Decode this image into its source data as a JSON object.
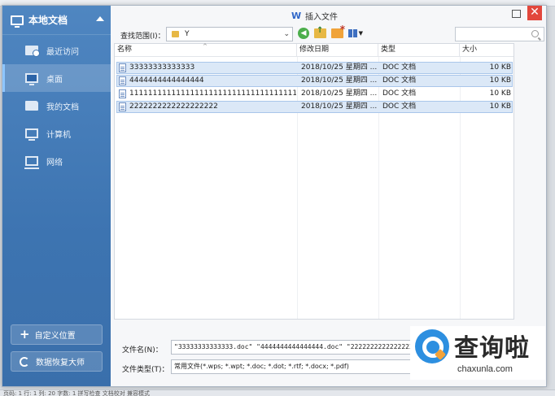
{
  "dialog": {
    "title": "插入文件",
    "close_glyph": "✕"
  },
  "sidebar": {
    "header": "本地文档",
    "items": [
      {
        "label": "最近访问"
      },
      {
        "label": "桌面"
      },
      {
        "label": "我的文档"
      },
      {
        "label": "计算机"
      },
      {
        "label": "网络"
      }
    ],
    "custom_location": "自定义位置",
    "data_recovery": "数据恢复大师"
  },
  "lookin": {
    "label": "查找范围(I)：",
    "value": "Y",
    "arrow": "⌄"
  },
  "columns": {
    "name": "名称",
    "modified": "修改日期",
    "type": "类型",
    "size": "大小",
    "sort_caret": "^"
  },
  "files": [
    {
      "name": "33333333333333",
      "modified": "2018/10/25 星期四 ...",
      "type": "DOC 文档",
      "size": "10 KB",
      "selected": true
    },
    {
      "name": "4444444444444444",
      "modified": "2018/10/25 星期四 ...",
      "type": "DOC 文档",
      "size": "10 KB",
      "selected": true
    },
    {
      "name": "111111111111111111111111111111111111...",
      "modified": "2018/10/25 星期四 ...",
      "type": "DOC 文档",
      "size": "10 KB",
      "selected": false
    },
    {
      "name": "2222222222222222222",
      "modified": "2018/10/25 星期四 ...",
      "type": "DOC 文档",
      "size": "10 KB",
      "selected": true
    }
  ],
  "filename": {
    "label": "文件名(N)：",
    "value": "\"33333333333333.doc\" \"4444444444444444.doc\" \"2222222222222222222\""
  },
  "filetype": {
    "label": "文件类型(T)：",
    "value": "常用文件(*.wps; *.wpt; *.doc; *.dot; *.rtf; *.docx; *.pdf)"
  },
  "statusbar": {
    "text": "页码: 1  行: 1  列: 20  字数: 1  拼写检查  文档校对  兼容模式"
  },
  "watermark": {
    "cn": "查询啦",
    "en": "chaxunla.com"
  },
  "colors": {
    "sidebar": "#4f86c1",
    "selection": "#dbe8f7",
    "close": "#e2473c"
  }
}
